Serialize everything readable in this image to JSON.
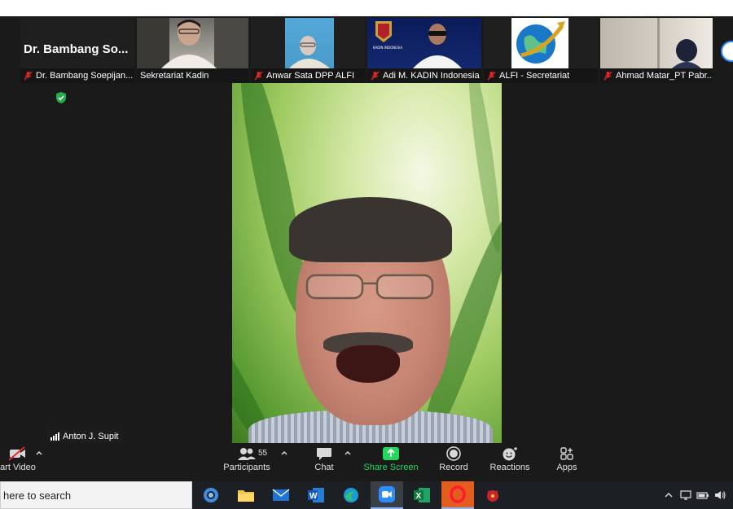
{
  "gallery": {
    "tiles": [
      {
        "name": "Dr. Bambang Soepijan...",
        "big_name": "Dr. Bambang So...",
        "muted": true
      },
      {
        "name": "Sekretariat Kadin",
        "muted": false
      },
      {
        "name": "Anwar Sata DPP ALFI",
        "muted": true
      },
      {
        "name": "Adi M. KADIN Indonesia",
        "muted": true
      },
      {
        "name": "ALFI - Secretariat",
        "muted": true
      },
      {
        "name": "Ahmad Matar_PT Pabr...",
        "muted": true
      }
    ],
    "kadin_logo_text": "KADIN INDONESIA"
  },
  "speaker": {
    "name": "Anton J. Supit"
  },
  "toolbar": {
    "start_video": "art Video",
    "participants": "Participants",
    "participant_count": "55",
    "chat": "Chat",
    "share_screen": "Share Screen",
    "record": "Record",
    "reactions": "Reactions",
    "apps": "Apps",
    "colors": {
      "share_green": "#23d959",
      "label": "#e0e0e0",
      "bg": "#1a1a1a"
    }
  },
  "taskbar": {
    "search_placeholder": "here to search",
    "apps": [
      "cortana-icon",
      "file-explorer-icon",
      "mail-icon",
      "word-icon",
      "edge-icon",
      "zoom-icon",
      "excel-icon",
      "opera-icon",
      "app-icon"
    ],
    "colors": {
      "bg": "#1c1f24",
      "search_bg": "#f3f3f3"
    }
  }
}
